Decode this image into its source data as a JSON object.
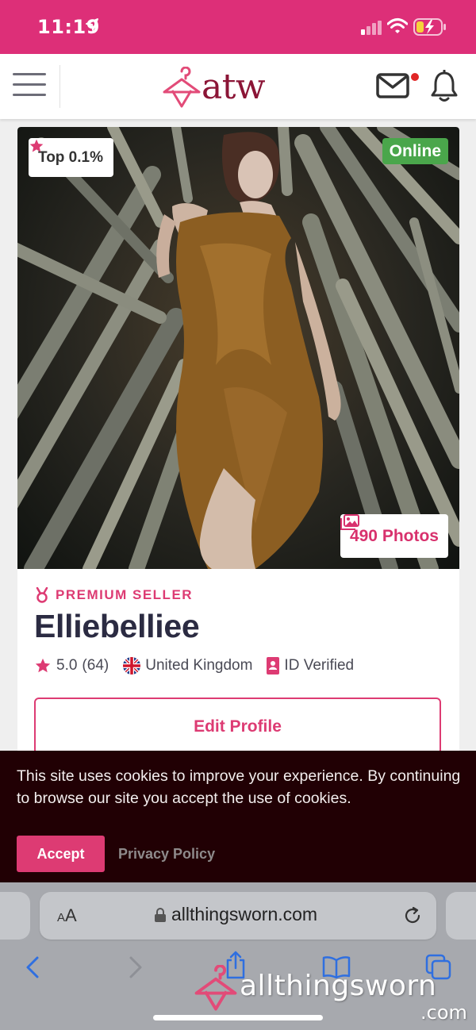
{
  "status_bar": {
    "time": "11:19"
  },
  "header": {
    "logo_text": "atw"
  },
  "profile": {
    "top_badge": "Top 0.1%",
    "online_badge": "Online",
    "photos_badge": "490 Photos",
    "premium_label": "PREMIUM SELLER",
    "seller_name": "Elliebelliee",
    "rating": "5.0",
    "rating_count": "(64)",
    "country": "United Kingdom",
    "verified": "ID Verified",
    "edit_button": "Edit Profile"
  },
  "cookie_banner": {
    "message": "This site uses cookies to improve your experience. By continuing to browse our site you accept the use of cookies.",
    "accept": "Accept",
    "privacy": "Privacy Policy"
  },
  "browser": {
    "aa_label_small": "A",
    "aa_label_large": "A",
    "url": "allthingsworn.com"
  },
  "watermark": {
    "text": "allthingsworn",
    "suffix": ".com"
  },
  "colors": {
    "brand_pink": "#dd2f78",
    "logo_maroon": "#8b1536",
    "accent": "#dd3b73",
    "online_green": "#4aa64b",
    "cookie_bg": "#210004"
  },
  "icons": [
    "location-arrow-icon",
    "signal-icon",
    "wifi-icon",
    "battery-charging-icon",
    "hamburger-icon",
    "hanger-logo-icon",
    "mail-icon",
    "bell-icon",
    "star-icon",
    "image-icon",
    "medal-icon",
    "uk-flag-icon",
    "id-card-icon",
    "lock-icon",
    "reload-icon",
    "back-icon",
    "forward-icon",
    "share-icon",
    "bookmarks-icon",
    "tabs-icon"
  ]
}
